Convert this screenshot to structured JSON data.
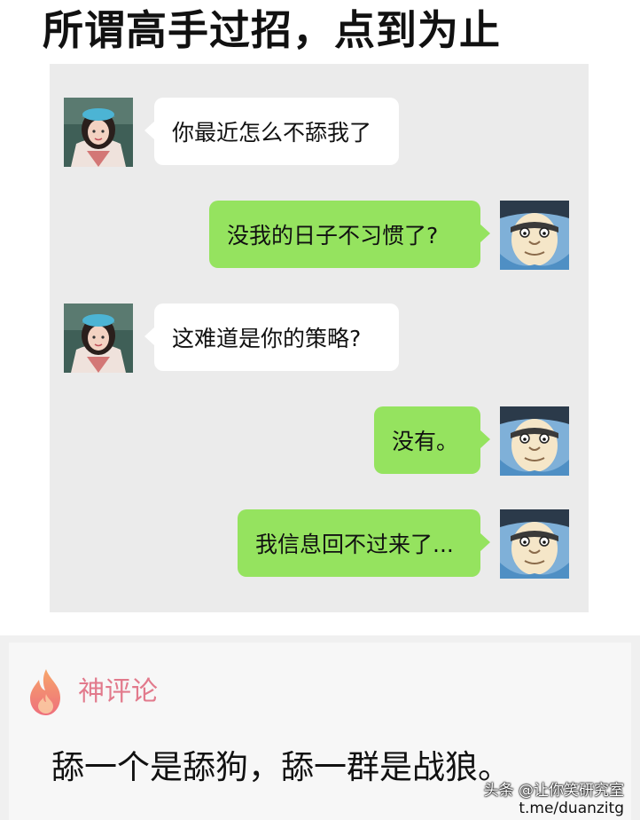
{
  "title": "所谓高手过招，点到为止",
  "messages": [
    {
      "side": "left",
      "text": "你最近怎么不舔我了"
    },
    {
      "side": "right",
      "text": "没我的日子不习惯了?"
    },
    {
      "side": "left",
      "text": "这难道是你的策略?"
    },
    {
      "side": "right",
      "text": "没有。"
    },
    {
      "side": "right",
      "text": "我信息回不过来了..."
    }
  ],
  "comment": {
    "label": "神评论",
    "text": "舔一个是舔狗，舔一群是战狼。"
  },
  "watermark": {
    "line1": "头条 @让你笑研究室",
    "line2": "t.me/duanzitg"
  },
  "colors": {
    "left_bubble": "#ffffff",
    "right_bubble": "#95e35f",
    "chat_background": "#ebebeb",
    "comment_label": "#e27a8c",
    "fire_icon": "#f28a5c"
  },
  "icons": {
    "left_avatar": "girl-avatar-icon",
    "right_avatar": "cartoon-face-avatar-icon",
    "comment": "fire-icon"
  }
}
